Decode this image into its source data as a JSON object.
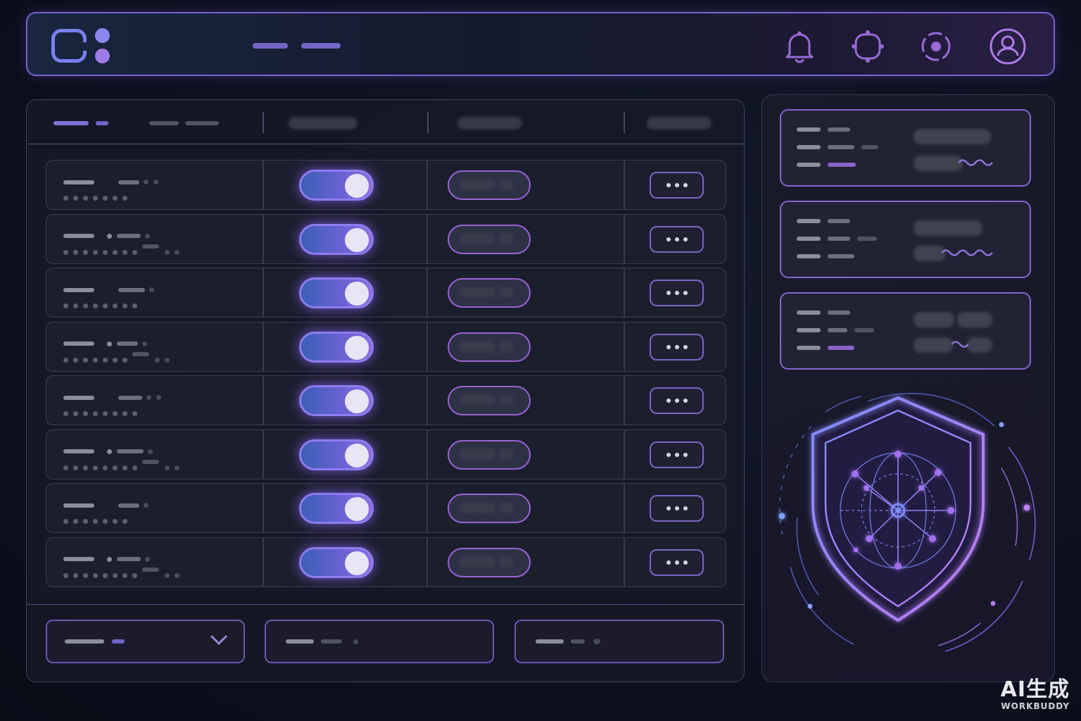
{
  "watermark": {
    "line1": "AI生成",
    "line2": "WORKBUDDY"
  },
  "topbar": {
    "icons": [
      "bell-icon",
      "sync-icon",
      "target-icon",
      "user-account-icon"
    ]
  },
  "table": {
    "row_count": 8,
    "toggles_on": [
      true,
      true,
      true,
      true,
      true,
      true,
      true,
      true
    ]
  },
  "security_graphic": {
    "icon": "shield-network-icon"
  },
  "colors": {
    "accent_blue": "#7a7ff0",
    "accent_purple": "#9a63d8",
    "background": "#0d1120",
    "border": "#7a63d6"
  }
}
